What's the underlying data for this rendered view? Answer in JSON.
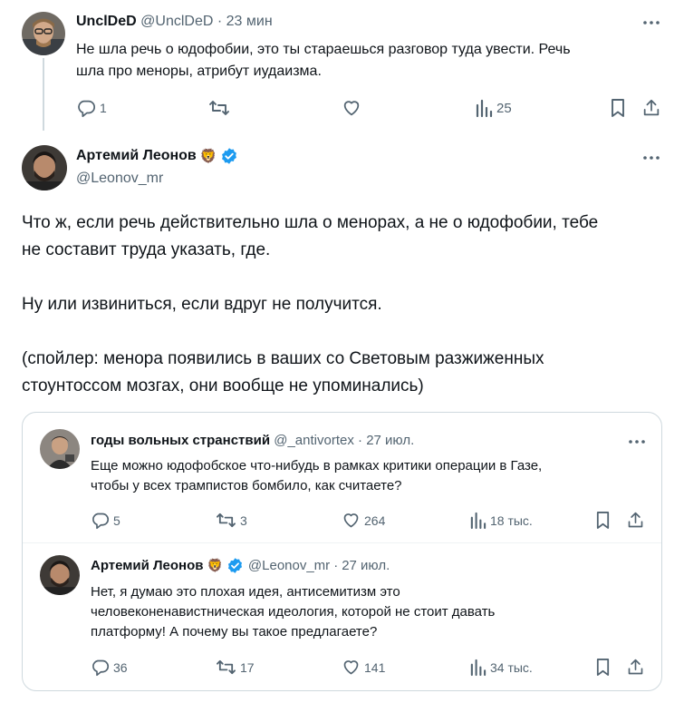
{
  "reply": {
    "name": "UnclDeD",
    "handle": "@UnclDeD",
    "separator": "·",
    "time": "23 мин",
    "text_line1": "Не шла речь о юдофобии, это ты стараешься разговор туда увести. Речь",
    "text_line2": "шла про меноры, атрибут иудаизма.",
    "reply_count": "1",
    "retweet_count": "",
    "like_count": "",
    "views_count": "25"
  },
  "main": {
    "name": "Артемий Леонов",
    "emoji": "🦁",
    "handle": "@Leonov_mr",
    "para1_line1": "Что ж, если речь действительно шла о менорах, а не о юдофобии, тебе",
    "para1_line2": "не составит труда указать, где.",
    "para2": "Ну или извиниться, если вдруг не получится.",
    "para3_line1": "(спойлер: менора появились в ваших со Световым разжиженных",
    "para3_line2": "стоунтоссом мозгах, они вообще не упоминались)"
  },
  "quote1": {
    "name": "годы вольных странствий",
    "handle": "@_antivortex",
    "separator": "·",
    "time": "27 июл.",
    "text_line1": "Еще можно юдофобское что-нибудь в рамках критики операции в Газе,",
    "text_line2": "чтобы у всех трампистов бомбило, как считаете?",
    "reply_count": "5",
    "retweet_count": "3",
    "like_count": "264",
    "views_count": "18 тыс."
  },
  "quote2": {
    "name": "Артемий Леонов",
    "emoji": "🦁",
    "handle": "@Leonov_mr",
    "separator": "·",
    "time": "27 июл.",
    "text_line1": "Нет, я думаю это плохая идея, антисемитизм это",
    "text_line2": "человеконенавистническая идеология, которой не стоит давать",
    "text_line3": "платформу! А почему вы такое предлагаете?",
    "reply_count": "36",
    "retweet_count": "17",
    "like_count": "141",
    "views_count": "34 тыс."
  },
  "colors": {
    "text": "#0f1419",
    "muted": "#536471",
    "verified": "#1d9bf0",
    "border": "#cfd9de"
  },
  "icons": [
    "more-icon",
    "reply-icon",
    "retweet-icon",
    "like-icon",
    "views-icon",
    "bookmark-icon",
    "share-icon",
    "verified-icon"
  ]
}
